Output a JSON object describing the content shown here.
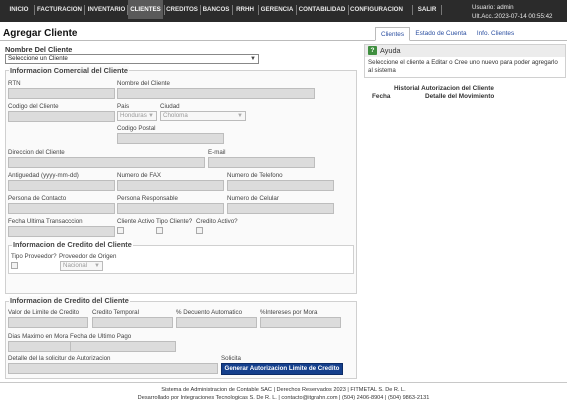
{
  "navbar": {
    "items": [
      {
        "label": "INICIO",
        "active": false
      },
      {
        "label": "FACTURACION",
        "active": false
      },
      {
        "label": "INVENTARIO",
        "active": false
      },
      {
        "label": "CLIENTES",
        "active": true
      },
      {
        "label": "CREDITOS",
        "active": false
      },
      {
        "label": "BANCOS",
        "active": false
      },
      {
        "label": "RRHH",
        "active": false
      },
      {
        "label": "GERENCIA",
        "active": false
      },
      {
        "label": "CONTABILIDAD",
        "active": false
      },
      {
        "label": "CONFIGURACION",
        "active": false
      },
      {
        "label": "SALIR",
        "active": false
      }
    ],
    "user_line": "Usuario: admin",
    "last_access_line": "Ult.Acc.:2023-07-14 00:55:42"
  },
  "page": {
    "title": "Agregar Cliente"
  },
  "tabs": [
    {
      "label": "Clientes",
      "active": true
    },
    {
      "label": "Estado de Cuenta",
      "active": false
    },
    {
      "label": "Info. Clientes",
      "active": false
    }
  ],
  "client_select": {
    "label": "Nombre Del Cliente",
    "value": "Seleccione un Cliente"
  },
  "commercial": {
    "legend": "Informacion Comercial del Cliente",
    "rtn_label": "RTN",
    "nombre_label": "Nombre del Cliente",
    "codigo_label": "Codigo del Cliente",
    "pais_label": "Pais",
    "pais_value": "Honduras",
    "ciudad_label": "Ciudad",
    "ciudad_value": "Choloma",
    "codigo_postal_label": "Codigo Postal",
    "direccion_label": "Direccion del Cliente",
    "email_label": "E-mail",
    "antiguedad_label": "Antiguedad (yyyy-mm-dd)",
    "fax_label": "Numero de FAX",
    "telefono_label": "Numero de Telefono",
    "persona_contacto_label": "Persona de Contacto",
    "persona_responsable_label": "Persona Responsable",
    "celular_label": "Numero de Celular",
    "fecha_transaccion_label": "Fecha Ultima Transacccion",
    "cliente_activo_label": "Cliente Activo",
    "tipo_cliente_label": "Tipo Cliente?",
    "credito_activo_label": "Credito Activo?"
  },
  "supplier_credit": {
    "legend": "Informacion de Credito del Cliente",
    "tipo_proveedor_label": "Tipo Proveedor?",
    "proveedor_origen_label": "Proveedor de Origen",
    "proveedor_origen_value": "Nacional"
  },
  "credit": {
    "legend": "Informacion de Credito del Cliente",
    "valor_limite_label": "Valor de Limite de Credito",
    "credito_temporal_label": "Credito Temporal",
    "descuento_label": "% Decuento Automatico",
    "intereses_label": "%Intereses por Mora",
    "dias_mora_label": "Dias Maximo en Mora",
    "fecha_ultimo_pago_label": "Fecha de Ultimo Pago",
    "detalle_label": "Detalle del la solicitur de Autorizacion",
    "solicita_label": "Solicita",
    "authorize_button": "Generar Autorizacion Limite de Credito"
  },
  "help": {
    "icon_glyph": "?",
    "title": "Ayuda",
    "text": "Seleccione el cliente a Editar o Cree uno nuevo para poder agregarlo al sistema"
  },
  "history": {
    "title": "Historial Autorizacion del Cliente",
    "col_fecha": "Fecha",
    "col_detalle": "Detalle del Movimiento"
  },
  "footer": {
    "line1": "Sistema de Administracion de Contable SAC | Derechos Reservados 2023 | FITMETAL S. De R. L.",
    "line2": "Desarrollado por Integraciones Tecnologicas S. De R. L. | contacto@itgrahn.com | (504) 2406-8904 | (504) 9863-2131"
  },
  "colors": {
    "navbar_bg": "#2b2b2b",
    "navbar_active": "#5a5a5a",
    "tab_link": "#2a4ea0",
    "primary_button": "#143f8c",
    "help_icon": "#3e8e3e",
    "input_fill": "#dcdcdc"
  }
}
